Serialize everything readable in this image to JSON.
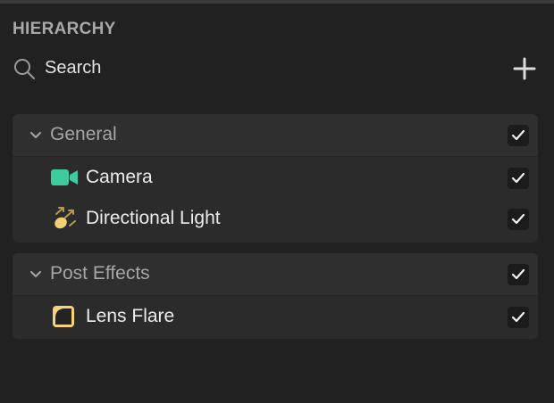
{
  "panel": {
    "title": "HIERARCHY"
  },
  "search": {
    "placeholder": "Search",
    "value": "",
    "icon": "search-icon"
  },
  "toolbar": {
    "add_icon": "plus-icon"
  },
  "groups": [
    {
      "label": "General",
      "expanded": true,
      "checked": true,
      "items": [
        {
          "label": "Camera",
          "icon": "camera-icon",
          "icon_color": "#3ec9a0",
          "checked": true
        },
        {
          "label": "Directional Light",
          "icon": "directional-light-icon",
          "icon_color": "#f2cf72",
          "checked": true
        }
      ]
    },
    {
      "label": "Post Effects",
      "expanded": true,
      "checked": true,
      "items": [
        {
          "label": "Lens Flare",
          "icon": "lens-flare-icon",
          "icon_color": "#f6d37a",
          "checked": true
        }
      ]
    }
  ],
  "colors": {
    "background": "#212121",
    "group_background": "#2b2b2b",
    "checkbox_background": "#1b1b1b",
    "muted_text": "#a6a6a6",
    "text": "#ececec"
  }
}
